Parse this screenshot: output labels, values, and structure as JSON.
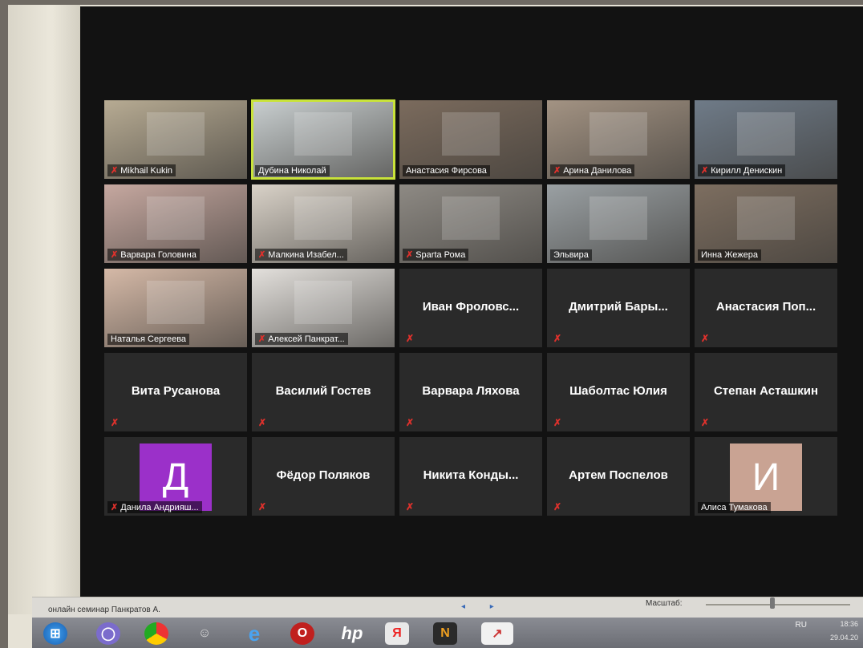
{
  "meeting": {
    "tiles": [
      {
        "kind": "video",
        "name": "Mikhail Kukin",
        "muted": true
      },
      {
        "kind": "video",
        "name": "Дубина Николай",
        "muted": false,
        "active": true
      },
      {
        "kind": "video",
        "name": "Анастасия Фирсова",
        "muted": false
      },
      {
        "kind": "video",
        "name": "Арина Данилова",
        "muted": true
      },
      {
        "kind": "video",
        "name": "Кирилл Денискин",
        "muted": true
      },
      {
        "kind": "video",
        "name": "Варвара Головина",
        "muted": true
      },
      {
        "kind": "video",
        "name": "Малкина Изабел...",
        "muted": true
      },
      {
        "kind": "video",
        "name": "Sparta Рома",
        "muted": true
      },
      {
        "kind": "video",
        "name": "Эльвира",
        "muted": false
      },
      {
        "kind": "video",
        "name": "Инна Жежера",
        "muted": false
      },
      {
        "kind": "video",
        "name": "Наталья Сергеева",
        "muted": false
      },
      {
        "kind": "video",
        "name": "Алексей Панкрат...",
        "muted": true
      },
      {
        "kind": "name",
        "name": "Иван  Фроловс...",
        "muted": true
      },
      {
        "kind": "name",
        "name": "Дмитрий  Бары...",
        "muted": true
      },
      {
        "kind": "name",
        "name": "Анастасия  Поп...",
        "muted": true
      },
      {
        "kind": "name",
        "name": "Вита Русанова",
        "muted": true
      },
      {
        "kind": "name",
        "name": "Василий Гостев",
        "muted": true
      },
      {
        "kind": "name",
        "name": "Варвара Ляхова",
        "muted": true
      },
      {
        "kind": "name",
        "name": "Шаболтас Юлия",
        "muted": true
      },
      {
        "kind": "name",
        "name": "Степан Асташкин",
        "muted": true
      },
      {
        "kind": "avatar",
        "name": "Данила Андрияш...",
        "initial": "Д",
        "color": "#9b30c9",
        "muted": true
      },
      {
        "kind": "name",
        "name": "Фёдор Поляков",
        "muted": true
      },
      {
        "kind": "name",
        "name": "Никита  Конды...",
        "muted": true
      },
      {
        "kind": "name",
        "name": "Артем Поспелов",
        "muted": true
      },
      {
        "kind": "avatar",
        "name": "Алиса Тумакова",
        "initial": "И",
        "color": "#c9a393",
        "muted": false
      }
    ]
  },
  "zoom_bar": {
    "meeting_title": "онлайн семинар Панкратов А.",
    "pager": "◂ ▸",
    "zoom_label": "Масштаб:"
  },
  "taskbar": {
    "lang": "RU",
    "time": "18:36",
    "date": "29.04.20"
  },
  "colors": {
    "active_border": "#c9e33a",
    "mute_red": "#e0312c"
  }
}
